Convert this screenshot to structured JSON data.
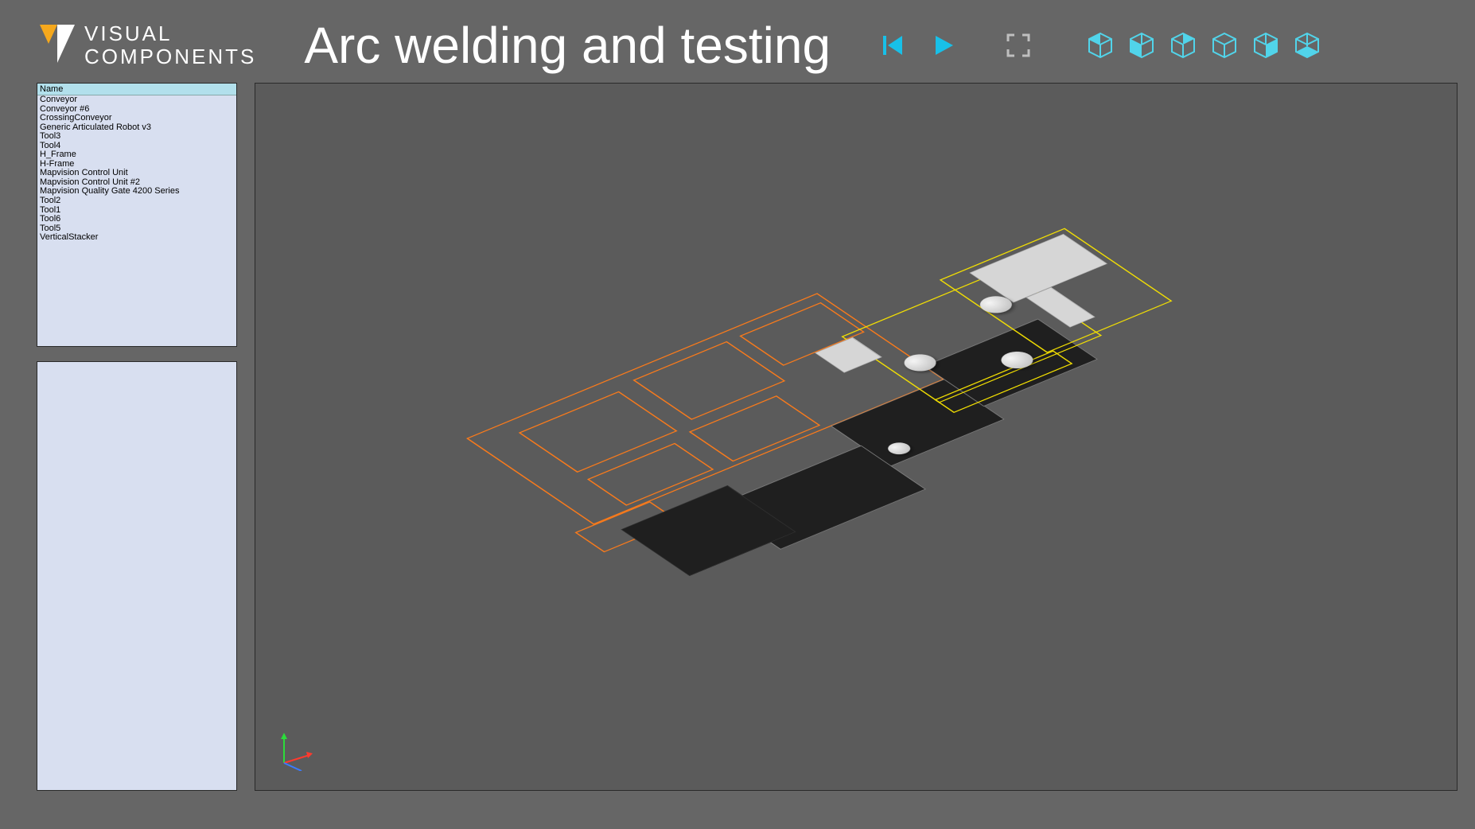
{
  "brand": {
    "line1": "VISUAL",
    "line2": "COMPONENTS"
  },
  "title": "Arc welding and testing",
  "sidebar": {
    "header": "Name",
    "items": [
      "Conveyor",
      "Conveyor #6",
      "CrossingConveyor",
      "Generic Articulated Robot v3",
      "Tool3",
      "Tool4",
      "H_Frame",
      "H-Frame",
      "Mapvision Control Unit",
      "Mapvision Control Unit #2",
      "Mapvision Quality Gate 4200 Series",
      "Tool2",
      "Tool1",
      "Tool6",
      "Tool5",
      "VerticalStacker"
    ]
  },
  "controls": {
    "restart": "restart",
    "play": "play",
    "fullscreen": "fullscreen"
  },
  "views": [
    "view-iso-front-left",
    "view-iso-front-right",
    "view-iso-back-left",
    "view-iso-back-right",
    "view-iso-bottom-left",
    "view-iso-bottom-right"
  ]
}
